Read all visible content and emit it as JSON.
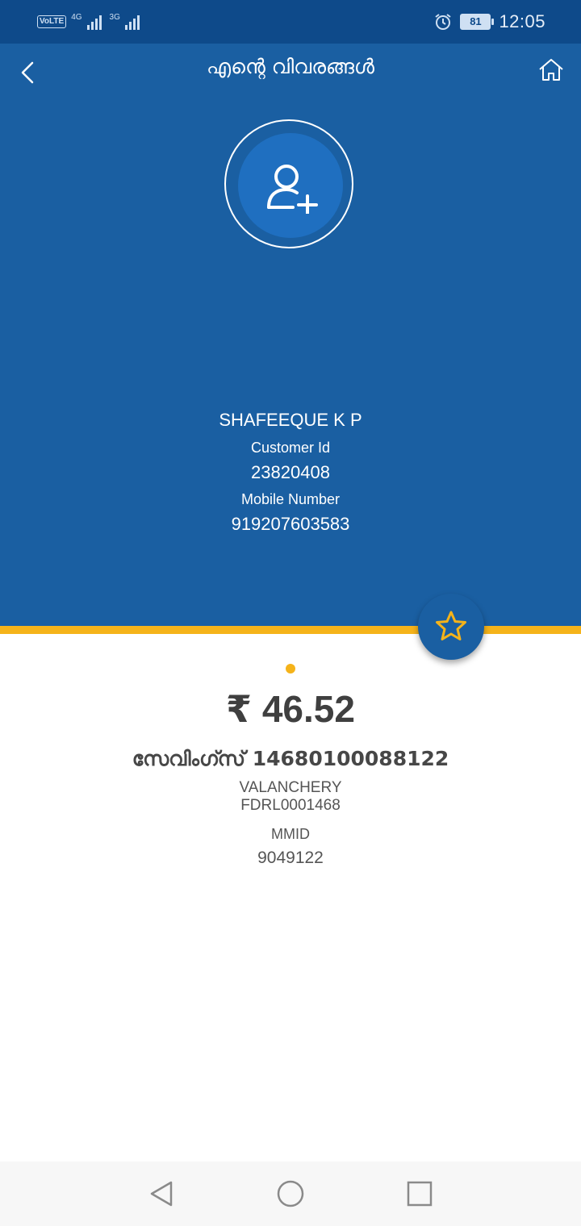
{
  "status_bar": {
    "volte": "VoLTE",
    "network_1": "4G",
    "network_2": "3G",
    "battery": "81",
    "time": "12:05",
    "icons": [
      "signal-icon",
      "alarm-icon",
      "battery-icon"
    ]
  },
  "header": {
    "title": "എന്റെ വിവരങ്ങൾ",
    "back_icon": "back-arrow-icon",
    "home_icon": "home-icon",
    "avatar_icon": "add-user-icon"
  },
  "profile": {
    "name": "SHAFEEQUE K P",
    "customer_id_label": "Customer Id",
    "customer_id": "23820408",
    "mobile_label": "Mobile Number",
    "mobile": "919207603583"
  },
  "account": {
    "favorite_icon": "star-icon",
    "balance": "₹ 46.52",
    "title": "സേവിംഗ്സ് 14680100088122",
    "branch": "VALANCHERY",
    "ifsc": "FDRL0001468",
    "mmid_label": "MMID",
    "mmid": "9049122"
  },
  "nav_bar": {
    "icons": [
      "nav-back-icon",
      "nav-home-icon",
      "nav-recent-icon"
    ]
  },
  "colors": {
    "status_bar": "#0e4a8a",
    "header": "#1a5fa2",
    "accent": "#f5b31a",
    "text_dark": "#3f3f3f"
  }
}
